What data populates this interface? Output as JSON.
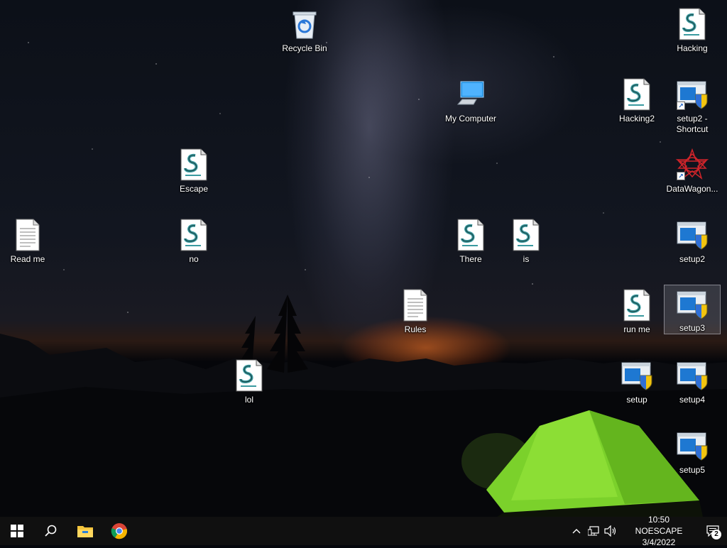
{
  "desktop": {
    "icons": [
      {
        "label": "Recycle Bin",
        "icon": "recycle-bin-icon"
      },
      {
        "label": "My Computer",
        "icon": "computer-icon"
      },
      {
        "label": "Hacking",
        "icon": "script-icon"
      },
      {
        "label": "Hacking2",
        "icon": "script-icon"
      },
      {
        "label": "setup2 - Shortcut",
        "icon": "installer-shortcut-icon"
      },
      {
        "label": "DataWagon...",
        "icon": "datawagon-shortcut-icon"
      },
      {
        "label": "Escape",
        "icon": "script-icon"
      },
      {
        "label": "Read me",
        "icon": "text-file-icon"
      },
      {
        "label": "no",
        "icon": "script-icon"
      },
      {
        "label": "There",
        "icon": "script-icon"
      },
      {
        "label": "is",
        "icon": "script-icon"
      },
      {
        "label": "setup2",
        "icon": "installer-icon"
      },
      {
        "label": "Rules",
        "icon": "text-file-icon"
      },
      {
        "label": "run me",
        "icon": "script-icon"
      },
      {
        "label": "setup3",
        "icon": "installer-icon"
      },
      {
        "label": "lol",
        "icon": "script-icon"
      },
      {
        "label": "setup",
        "icon": "installer-icon"
      },
      {
        "label": "setup4",
        "icon": "installer-icon"
      },
      {
        "label": "setup5",
        "icon": "installer-icon"
      }
    ]
  },
  "taskbar": {
    "start": "windows-start-icon",
    "search": "search-icon",
    "pinned": [
      {
        "name": "file-explorer-icon"
      },
      {
        "name": "chrome-icon"
      }
    ],
    "tray": {
      "chevron": "^",
      "clock_time": "10:50 NOESCAPE",
      "clock_date": "3/4/2022",
      "notification_count": "2"
    }
  }
}
